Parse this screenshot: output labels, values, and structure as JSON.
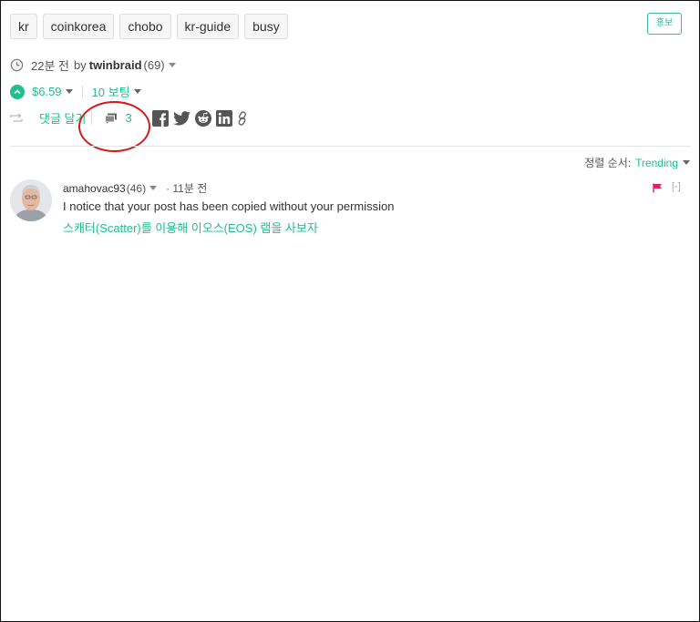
{
  "tags": [
    "kr",
    "coinkorea",
    "chobo",
    "kr-guide",
    "busy"
  ],
  "promote_label": "홍보",
  "post_meta": {
    "time": "22분 전",
    "by": "by",
    "author": "twinbraid",
    "reputation": "(69)"
  },
  "voting": {
    "payout": "$6.59",
    "votes": "10 보팅"
  },
  "actions": {
    "reply": "댓글 달기",
    "comment_count": "3"
  },
  "share_icons": [
    "facebook-icon",
    "twitter-icon",
    "reddit-icon",
    "linkedin-icon",
    "link-icon"
  ],
  "sort": {
    "label": "정렬 순서:",
    "value": "Trending"
  },
  "comment": {
    "author": "amahovac93",
    "reputation": "(46)",
    "time": "· 11분 전",
    "body": "I notice that your post has been copied without your permission",
    "link_text": "스캐터(Scatter)를 이용해 이오스(EOS) 램을 사보자",
    "collapse": "[-]"
  },
  "colors": {
    "accent": "#1fbf8f",
    "annotation_red": "#d41a1a",
    "flag": "#e0245e"
  }
}
